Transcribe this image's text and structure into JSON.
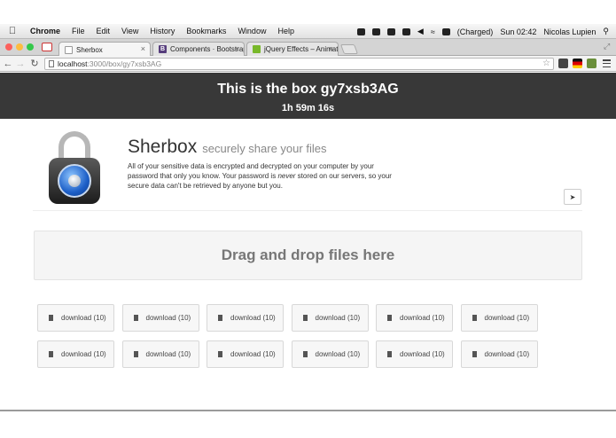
{
  "menubar": {
    "app_name": "Chrome",
    "items": [
      "File",
      "Edit",
      "View",
      "History",
      "Bookmarks",
      "Window",
      "Help"
    ],
    "battery": "(Charged)",
    "clock": "Sun 02:42",
    "user": "Nicolas Lupien"
  },
  "tabs": [
    {
      "label": "Sherbox",
      "active": true
    },
    {
      "label": "Components · Bootstrap",
      "active": false
    },
    {
      "label": "jQuery Effects – Animation",
      "active": false
    }
  ],
  "address": {
    "host": "localhost",
    "path": ":3000/box/gy7xsb3AG"
  },
  "header": {
    "title": "This is the box gy7xsb3AG",
    "timer": "1h 59m 16s"
  },
  "jumbotron": {
    "brand": "Sherbox",
    "tagline": "securely share your files",
    "desc_before": "All of your sensitive data is encrypted and decrypted on your computer by your password that only you know. Your password is ",
    "desc_em": "never",
    "desc_after": " stored on our servers, so your secure data can't be retrieved by anyone but you."
  },
  "dropzone": {
    "label": "Drag and drop files here"
  },
  "downloads": [
    "download (10)",
    "download (10)",
    "download (10)",
    "download (10)",
    "download (10)",
    "download (10)",
    "download (10)",
    "download (10)",
    "download (10)",
    "download (10)",
    "download (10)",
    "download (10)"
  ],
  "icons": {
    "apple": "apple-icon",
    "send": "send-icon",
    "file": "file-icon",
    "lock": "padlock-icon"
  },
  "colors": {
    "header_bg": "#383838",
    "dropzone_bg": "#f5f5f5"
  }
}
